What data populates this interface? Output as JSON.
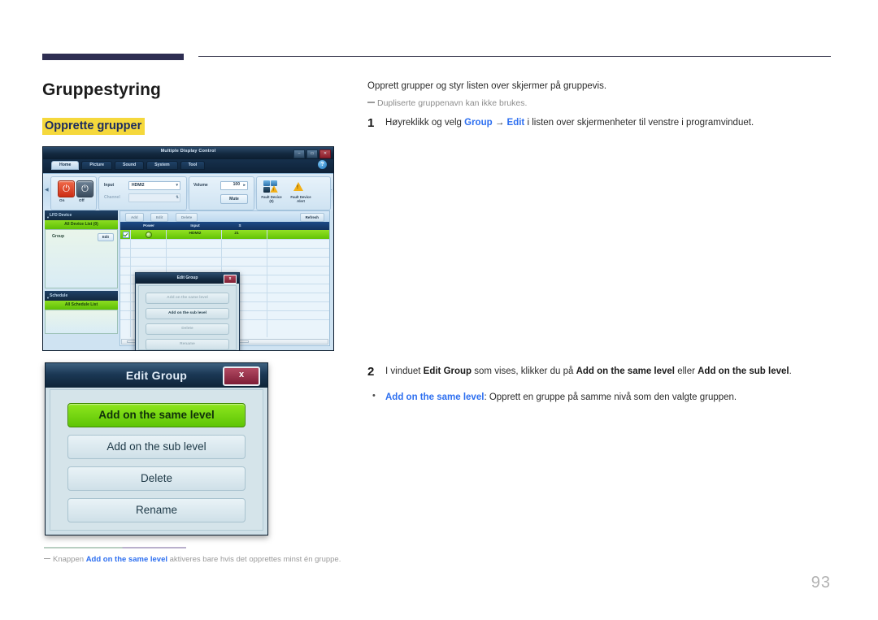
{
  "header": {
    "rule_color": "#2e2e52"
  },
  "page": {
    "title": "Gruppestyring",
    "subtitle": "Opprette grupper",
    "number": "93"
  },
  "intro": "Opprett grupper og styr listen over skjermer på gruppevis.",
  "note": "Dupliserte gruppenavn kan ikke brukes.",
  "steps": [
    {
      "num": "1",
      "parts": [
        {
          "t": "Høyreklikk og velg ",
          "s": "n"
        },
        {
          "t": "Group",
          "s": "b"
        },
        {
          "t": " → ",
          "s": "n"
        },
        {
          "t": "Edit",
          "s": "b"
        },
        {
          "t": " i listen over skjermenheter til venstre i programvinduet.",
          "s": "n"
        }
      ]
    },
    {
      "num": "2",
      "parts": [
        {
          "t": "I vinduet ",
          "s": "n"
        },
        {
          "t": "Edit Group",
          "s": "k"
        },
        {
          "t": " som vises, klikker du på ",
          "s": "n"
        },
        {
          "t": "Add on the same level",
          "s": "k"
        },
        {
          "t": " eller ",
          "s": "n"
        },
        {
          "t": "Add on the sub level",
          "s": "k"
        },
        {
          "t": ".",
          "s": "n"
        }
      ]
    }
  ],
  "bullet": {
    "marker": "•",
    "parts": [
      {
        "t": "Add on the same level",
        "s": "b"
      },
      {
        "t": ": Opprett en gruppe på samme nivå som den valgte gruppen.",
        "s": "n"
      }
    ]
  },
  "footnote": {
    "parts": [
      {
        "t": "Knappen ",
        "s": "n"
      },
      {
        "t": "Add on the same level",
        "s": "b"
      },
      {
        "t": " aktiveres bare hvis det opprettes minst én gruppe.",
        "s": "n"
      }
    ]
  },
  "app": {
    "title": "Multiple Display Control",
    "window_buttons": [
      "–",
      "▭",
      "✕"
    ],
    "tabs": [
      "Home",
      "Picture",
      "Sound",
      "System",
      "Tool"
    ],
    "active_tab": "Home",
    "help_label": "?",
    "power": {
      "on_label": "On",
      "off_label": "Off"
    },
    "input": {
      "label": "Input",
      "value": "HDMI2",
      "channel_label": "Channel",
      "channel_value": ""
    },
    "volume": {
      "label": "Volume",
      "value": "100",
      "mute_label": "Mute"
    },
    "fault": {
      "device_label_1": "Fault Device",
      "device_label_2": "(0)",
      "alert_label_1": "Fault Device",
      "alert_label_2": "Alert"
    },
    "sidebar": {
      "device_section": "LFD Device",
      "all_device_list": "All Device List (0)",
      "group_label": "Group",
      "group_edit_label": "Edit",
      "schedule_section": "Schedule",
      "all_schedule_list": "All Schedule List"
    },
    "grid": {
      "toolbar": [
        "Add",
        "Edit",
        "Delete",
        "Refresh"
      ],
      "headers": [
        "Power",
        "Input",
        "S"
      ],
      "row": {
        "input": "HDMI2",
        "extra": "21"
      }
    },
    "mini_dialog": {
      "title": "Edit Group",
      "close": "x",
      "buttons": [
        {
          "label": "Add on the same level",
          "enabled": false
        },
        {
          "label": "Add on the sub level",
          "enabled": true
        },
        {
          "label": "Delete",
          "enabled": false
        },
        {
          "label": "Rename",
          "enabled": false
        }
      ]
    }
  },
  "dialog": {
    "title": "Edit Group",
    "close": "x",
    "buttons": [
      {
        "label": "Add on the same level",
        "highlight": true
      },
      {
        "label": "Add on the sub level",
        "highlight": false
      },
      {
        "label": "Delete",
        "highlight": false
      },
      {
        "label": "Rename",
        "highlight": false
      }
    ]
  }
}
